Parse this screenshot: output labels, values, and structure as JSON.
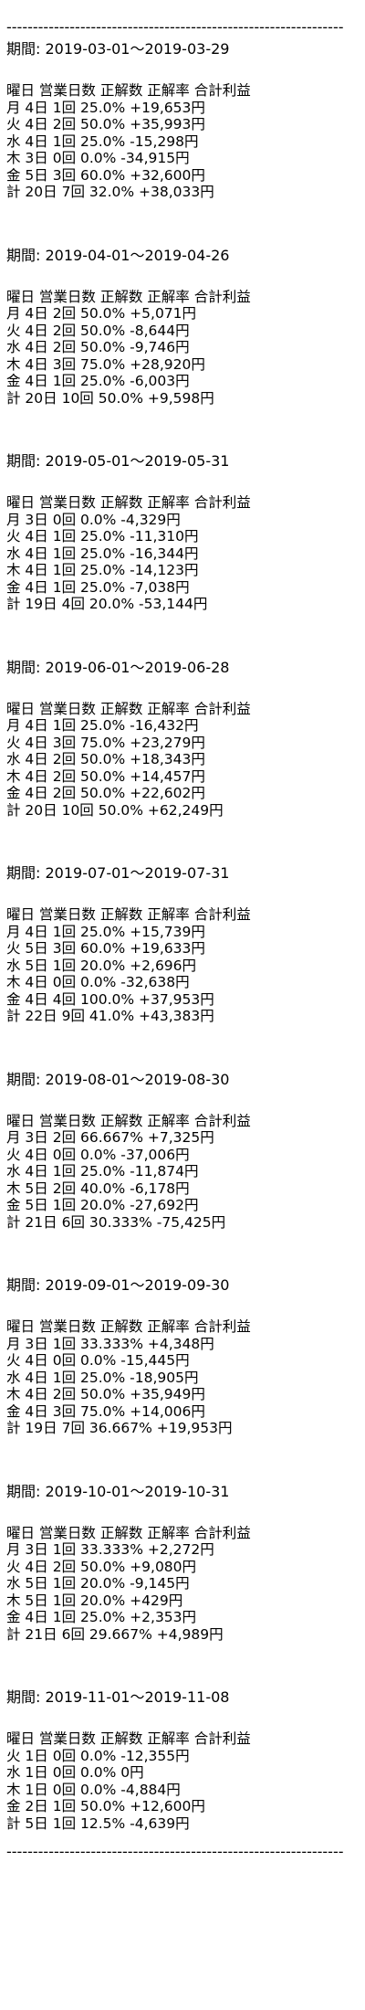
{
  "divider": "----------------------------------------------------------------",
  "header": "曜日 営業日数 正解数 正解率 合計利益",
  "sections": [
    {
      "period": "期間: 2019-03-01～2019-03-29",
      "rows": [
        "月 4日 1回 25.0% +19,653円",
        "火 4日 2回 50.0% +35,993円",
        "水 4日 1回 25.0% -15,298円",
        "木 3日 0回 0.0% -34,915円",
        "金 5日 3回 60.0% +32,600円",
        "計 20日 7回 32.0% +38,033円"
      ]
    },
    {
      "period": "期間: 2019-04-01～2019-04-26",
      "rows": [
        "月 4日 2回 50.0% +5,071円",
        "火 4日 2回 50.0% -8,644円",
        "水 4日 2回 50.0% -9,746円",
        "木 4日 3回 75.0% +28,920円",
        "金 4日 1回 25.0% -6,003円",
        "計 20日 10回 50.0% +9,598円"
      ]
    },
    {
      "period": "期間: 2019-05-01～2019-05-31",
      "rows": [
        "月 3日 0回 0.0% -4,329円",
        "火 4日 1回 25.0% -11,310円",
        "水 4日 1回 25.0% -16,344円",
        "木 4日 1回 25.0% -14,123円",
        "金 4日 1回 25.0% -7,038円",
        "計 19日 4回 20.0% -53,144円"
      ]
    },
    {
      "period": "期間: 2019-06-01～2019-06-28",
      "rows": [
        "月 4日 1回 25.0% -16,432円",
        "火 4日 3回 75.0% +23,279円",
        "水 4日 2回 50.0% +18,343円",
        "木 4日 2回 50.0% +14,457円",
        "金 4日 2回 50.0% +22,602円",
        "計 20日 10回 50.0% +62,249円"
      ]
    },
    {
      "period": "期間: 2019-07-01～2019-07-31",
      "rows": [
        "月 4日 1回 25.0% +15,739円",
        "火 5日 3回 60.0% +19,633円",
        "水 5日 1回 20.0% +2,696円",
        "木 4日 0回 0.0% -32,638円",
        "金 4日 4回 100.0% +37,953円",
        "計 22日 9回 41.0% +43,383円"
      ]
    },
    {
      "period": "期間: 2019-08-01～2019-08-30",
      "rows": [
        "月 3日 2回 66.667% +7,325円",
        "火 4日 0回 0.0% -37,006円",
        "水 4日 1回 25.0% -11,874円",
        "木 5日 2回 40.0% -6,178円",
        "金 5日 1回 20.0% -27,692円",
        "計 21日 6回 30.333% -75,425円"
      ]
    },
    {
      "period": "期間: 2019-09-01～2019-09-30",
      "rows": [
        "月 3日 1回 33.333% +4,348円",
        "火 4日 0回 0.0% -15,445円",
        "水 4日 1回 25.0% -18,905円",
        "木 4日 2回 50.0% +35,949円",
        "金 4日 3回 75.0% +14,006円",
        "計 19日 7回 36.667% +19,953円"
      ]
    },
    {
      "period": "期間: 2019-10-01～2019-10-31",
      "rows": [
        "月 3日 1回 33.333% +2,272円",
        "火 4日 2回 50.0% +9,080円",
        "水 5日 1回 20.0% -9,145円",
        "木 5日 1回 20.0% +429円",
        "金 4日 1回 25.0% +2,353円",
        "計 21日 6回 29.667% +4,989円"
      ]
    },
    {
      "period": "期間: 2019-11-01～2019-11-08",
      "rows": [
        "火 1日 0回 0.0% -12,355円",
        "水 1日 0回 0.0% 0円",
        "木 1日 0回 0.0% -4,884円",
        "金 2日 1回 50.0% +12,600円",
        "計 5日 1回 12.5% -4,639円"
      ]
    }
  ]
}
